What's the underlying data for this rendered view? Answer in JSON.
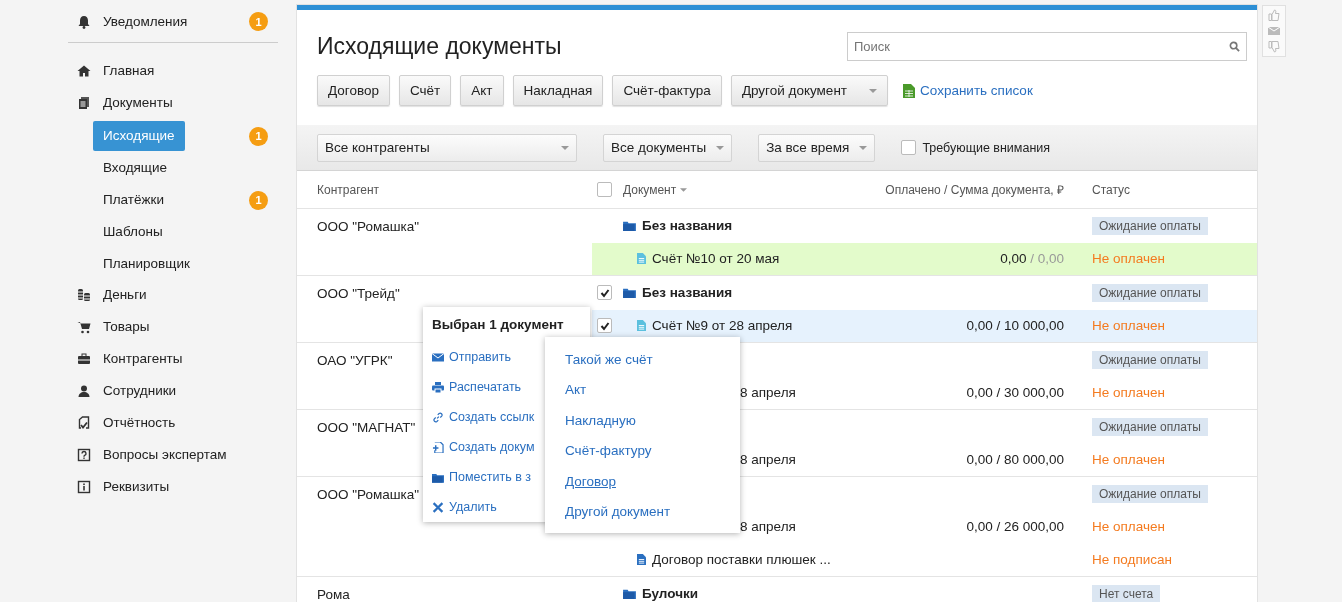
{
  "sidebar": {
    "notifications": {
      "label": "Уведомления",
      "badge": "1"
    },
    "items": [
      {
        "label": "Главная"
      },
      {
        "label": "Документы",
        "children": [
          {
            "label": "Исходящие",
            "selected": true,
            "badge": "1"
          },
          {
            "label": "Входящие",
            "selected": false
          },
          {
            "label": "Платёжки",
            "selected": false,
            "badge": "1"
          },
          {
            "label": "Шаблоны",
            "selected": false
          },
          {
            "label": "Планировщик",
            "selected": false
          }
        ]
      },
      {
        "label": "Деньги"
      },
      {
        "label": "Товары"
      },
      {
        "label": "Контрагенты"
      },
      {
        "label": "Сотрудники"
      },
      {
        "label": "Отчётность"
      },
      {
        "label": "Вопросы экспертам"
      },
      {
        "label": "Реквизиты"
      }
    ]
  },
  "page": {
    "title": "Исходящие документы",
    "search": {
      "placeholder": "Поиск"
    },
    "create_buttons": [
      {
        "label": "Договор",
        "dropdown": false
      },
      {
        "label": "Счёт",
        "dropdown": false
      },
      {
        "label": "Акт",
        "dropdown": false
      },
      {
        "label": "Накладная",
        "dropdown": false
      },
      {
        "label": "Счёт-фактура",
        "dropdown": false
      },
      {
        "label": "Другой документ",
        "dropdown": true
      }
    ],
    "save_link": "Сохранить список",
    "filters": {
      "contractor": "Все контрагенты",
      "documents": "Все документы",
      "period": "За все время",
      "attention": {
        "label": "Требующие внимания",
        "checked": false
      }
    }
  },
  "table": {
    "columns": [
      "Контрагент",
      "Документ",
      "Оплачено / Сумма документа, ₽",
      "Статус"
    ],
    "header_checked": false,
    "rows": [
      {
        "contractor": "ООО \"Ромашка\"",
        "folder": {
          "title": "Без названия",
          "checked": false,
          "badge": "Ожидание оплаты"
        },
        "docs": [
          {
            "kind": "invoice",
            "title": "Счёт №10 от 20 мая",
            "paid": "0,00",
            "total": "/ 0,00",
            "total_muted": true,
            "status": "Не оплачен",
            "checked": false,
            "selected": false,
            "is_new": true
          }
        ]
      },
      {
        "contractor": "ООО \"Трейд\"",
        "folder": {
          "title": "Без названия",
          "checked": true,
          "badge": "Ожидание оплаты"
        },
        "docs": [
          {
            "kind": "invoice",
            "title": "Счёт №9 от 28 апреля",
            "paid": "0,00",
            "total": "/ 10 000,00",
            "total_muted": false,
            "status": "Не оплачен",
            "checked": true,
            "selected": true,
            "is_new": false
          }
        ]
      },
      {
        "contractor": "ОАО \"УГРК\"",
        "folder": {
          "badge": "Ожидание оплаты"
        },
        "docs": [
          {
            "kind": "partial",
            "title": "8 апреля",
            "paid": "0,00",
            "total": "/ 30 000,00",
            "total_muted": false,
            "status": "Не оплачен",
            "selected": false,
            "is_new": false
          }
        ]
      },
      {
        "contractor": "ООО \"МАГНАТ\"",
        "folder": {
          "badge": "Ожидание оплаты"
        },
        "docs": [
          {
            "kind": "partial",
            "title": "8 апреля",
            "paid": "0,00",
            "total": "/ 80 000,00",
            "total_muted": false,
            "status": "Не оплачен",
            "selected": false,
            "is_new": false
          }
        ]
      },
      {
        "contractor": "ООО \"Ромашка\"",
        "folder": {
          "badge": "Ожидание оплаты"
        },
        "docs": [
          {
            "kind": "partial",
            "title": "8 апреля",
            "paid": "0,00",
            "total": "/ 26 000,00",
            "total_muted": false,
            "status": "Не оплачен",
            "checked": false,
            "selected": false,
            "is_new": false
          },
          {
            "kind": "contract",
            "title": "Договор поставки плюшек ...",
            "status": "Не подписан",
            "checked": false,
            "selected": false,
            "is_new": false
          }
        ]
      },
      {
        "contractor": "Рома",
        "folder": {
          "title": "Булочки",
          "checked": false,
          "badge": "Нет счета"
        },
        "docs": []
      }
    ]
  },
  "popup": {
    "title": "Выбран 1 документ",
    "actions": [
      {
        "label": "Отправить"
      },
      {
        "label": "Распечатать"
      },
      {
        "label": "Создать ссылк"
      },
      {
        "label": "Создать докум"
      },
      {
        "label": "Поместить в з"
      },
      {
        "label": "Удалить"
      }
    ],
    "submenu": [
      {
        "label": "Такой же счёт",
        "selected": false
      },
      {
        "label": "Акт",
        "selected": false
      },
      {
        "label": "Накладную",
        "selected": false
      },
      {
        "label": "Счёт-фактуру",
        "selected": false
      },
      {
        "label": "Договор",
        "selected": true
      },
      {
        "label": "Другой документ",
        "selected": false
      }
    ]
  }
}
